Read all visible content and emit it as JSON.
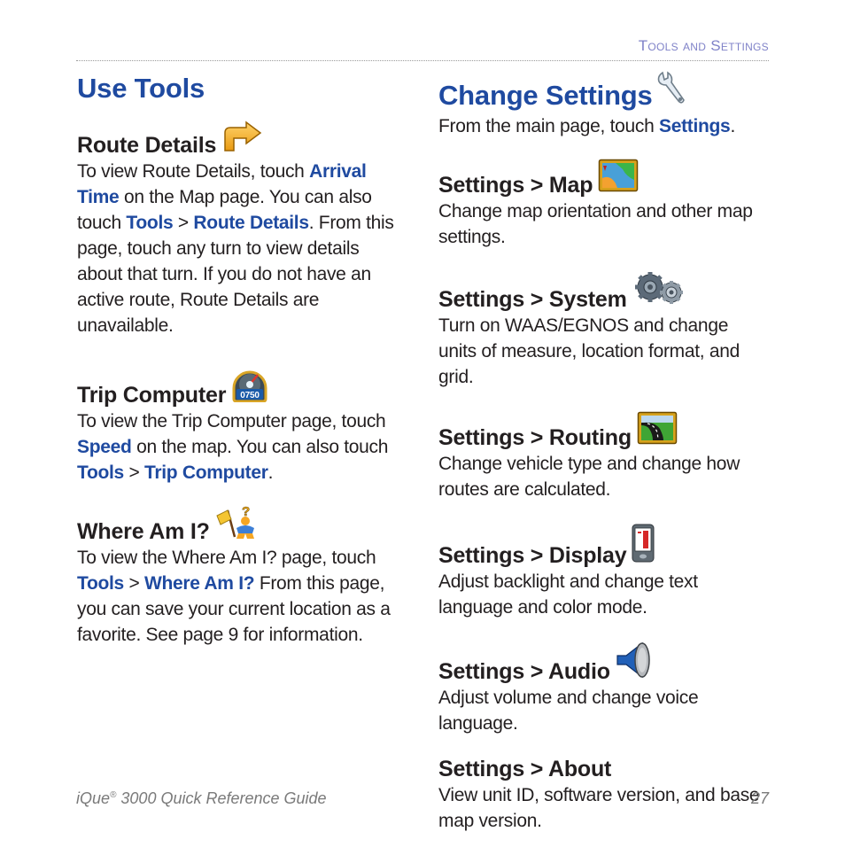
{
  "header": {
    "section_title": "Tools and Settings"
  },
  "left": {
    "title": "Use Tools",
    "route_details": {
      "heading": "Route Details",
      "icon": "turn-arrow-icon",
      "t1": "To view Route Details, touch ",
      "b1": "Arrival Time",
      "t2": " on the Map page. You can also touch ",
      "b2": "Tools",
      "t3": " > ",
      "b3": "Route Details",
      "t4": ". From this page, touch any turn to view details about that turn. If you do not have an active route, Route Details are unavailable."
    },
    "trip_computer": {
      "heading": "Trip Computer",
      "icon": "speedometer-icon",
      "icon_readout": "0750",
      "t1": "To view the Trip Computer page, touch ",
      "b1": "Speed",
      "t2": " on the map. You can also touch ",
      "b2": "Tools",
      "t3": " > ",
      "b3": "Trip Computer",
      "t4": "."
    },
    "where_am_i": {
      "heading": "Where Am I?",
      "icon": "where-am-i-person-flag-icon",
      "t1": "To view the Where Am I? page, touch ",
      "b1": "Tools",
      "t2": " > ",
      "b2": "Where Am I?",
      "t3": " From this page, you can save your current location as a favorite. See page 9 for information."
    }
  },
  "right": {
    "title": "Change Settings",
    "title_icon": "wrench-icon",
    "intro_t1": "From the main page, touch ",
    "intro_b1": "Settings",
    "intro_t2": ".",
    "sections": [
      {
        "heading": "Settings > Map",
        "icon": "map-icon",
        "body": "Change map orientation and other map settings."
      },
      {
        "heading": "Settings > System",
        "icon": "gears-icon",
        "body": "Turn on WAAS/EGNOS and change units of measure, location format, and grid."
      },
      {
        "heading": "Settings > Routing",
        "icon": "road-icon",
        "body": "Change vehicle type and change how routes are calculated."
      },
      {
        "heading": "Settings > Display",
        "icon": "handheld-display-icon",
        "body": "Adjust backlight and change text language and color mode."
      },
      {
        "heading": "Settings > Audio",
        "icon": "speaker-icon",
        "body": "Adjust volume and change voice language."
      },
      {
        "heading": "Settings > About",
        "icon": "",
        "body": "View unit ID, software version, and base map version."
      }
    ]
  },
  "footer": {
    "guide_name_prefix": "iQue",
    "registered_mark": "®",
    "guide_name_suffix": " 3000 Quick Reference Guide",
    "page_number": "27"
  }
}
